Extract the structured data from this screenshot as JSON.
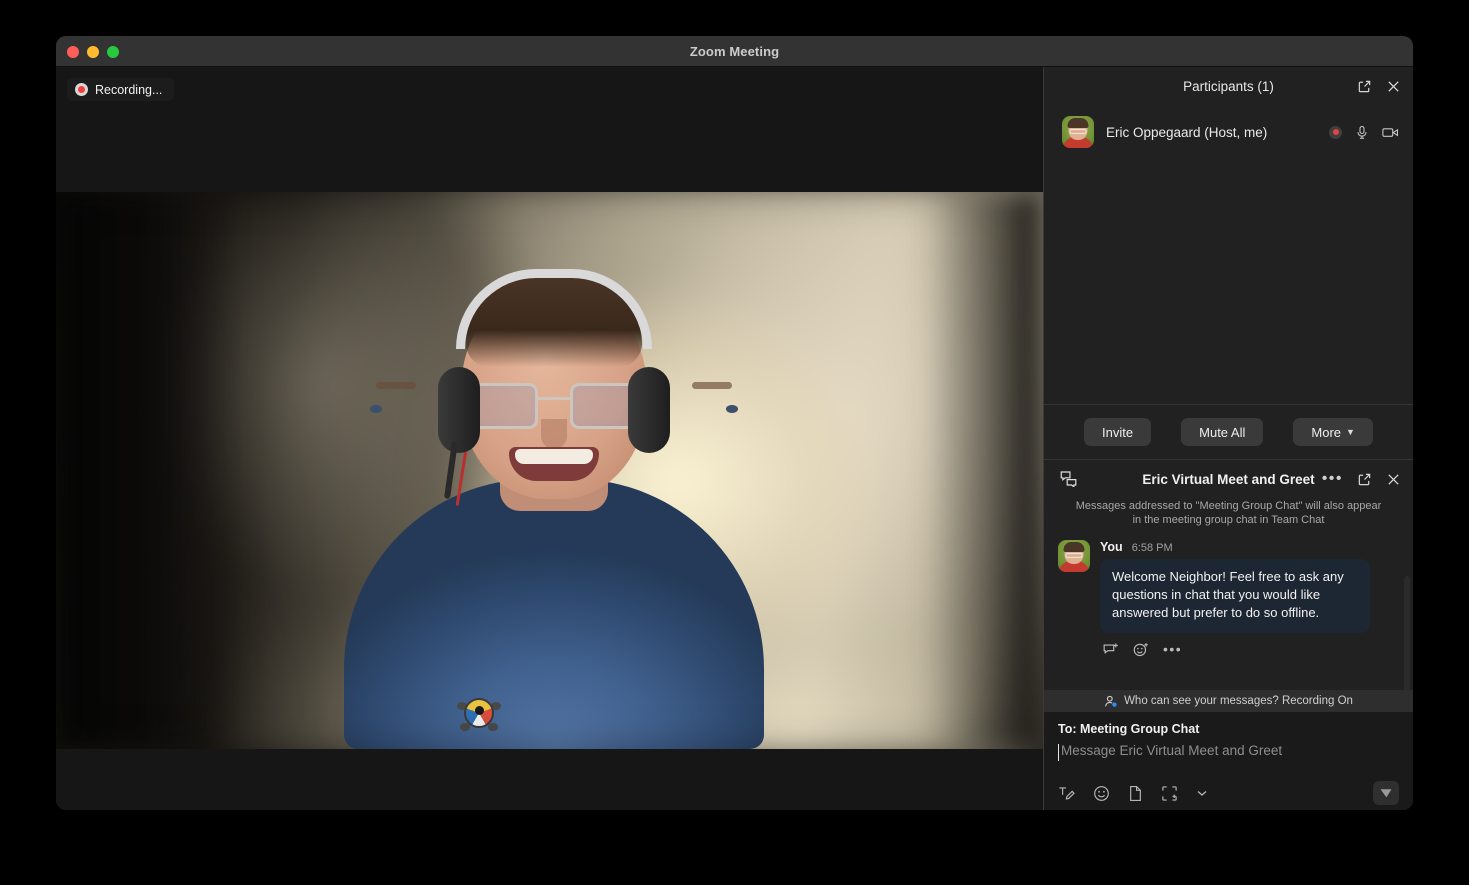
{
  "window": {
    "title": "Zoom Meeting",
    "traffic_lights": [
      "close-red",
      "minimize-yellow",
      "maximize-green"
    ]
  },
  "stage": {
    "recording_badge": {
      "label": "Recording...",
      "icon": "record-dot-icon",
      "dot_color": "#ef3f3f"
    },
    "video": {
      "description": "Blurred warm beige room background with smiling person wearing headset, glasses and blue t-shirt with turtle logo and red lanyard",
      "shirt_color": "#3f5f8c",
      "background_color": "#c9c0a6"
    }
  },
  "participants_panel": {
    "title": "Participants (1)",
    "header_icons": [
      "popout-icon",
      "close-icon"
    ],
    "list": [
      {
        "name": "Eric Oppegaard (Host, me)",
        "avatar": "user-avatar",
        "status_icons": [
          "recording-dot-icon",
          "microphone-icon",
          "video-camera-icon"
        ]
      }
    ],
    "actions": {
      "invite_label": "Invite",
      "mute_all_label": "Mute All",
      "more_label": "More",
      "more_chevron": "chevron-down-icon"
    }
  },
  "chat_panel": {
    "icon": "chat-bubbles-icon",
    "title": "Eric Virtual Meet and Greet",
    "header_icons": [
      "more-options-icon",
      "popout-icon",
      "close-icon"
    ],
    "notice": "Messages addressed to \"Meeting Group Chat\" will also appear in the meeting group chat in Team Chat",
    "messages": [
      {
        "author": "You",
        "time": "6:58 PM",
        "text": "Welcome Neighbor!  Feel free to ask any questions in chat that you would like answered but prefer to do so offline.",
        "actions": [
          "reply-icon",
          "add-reaction-icon",
          "more-actions-icon"
        ]
      }
    ],
    "privacy_bar": {
      "icon": "person-privacy-icon",
      "text": "Who can see your messages? Recording On"
    },
    "compose": {
      "to_label": "To: Meeting Group Chat",
      "placeholder": "Message Eric Virtual Meet and Greet",
      "value": "",
      "tools": [
        "format-text-icon",
        "emoji-icon",
        "file-icon",
        "screenshot-icon",
        "chevron-down-icon"
      ],
      "send_icon": "send-paper-plane-icon"
    }
  },
  "colors": {
    "window_bg": "#1a1a1a",
    "titlebar": "#333333",
    "panel_bg": "#212121",
    "bubble_bg": "#1d2733",
    "button_bg": "#3a3a3a",
    "accent_red": "#e04444"
  }
}
